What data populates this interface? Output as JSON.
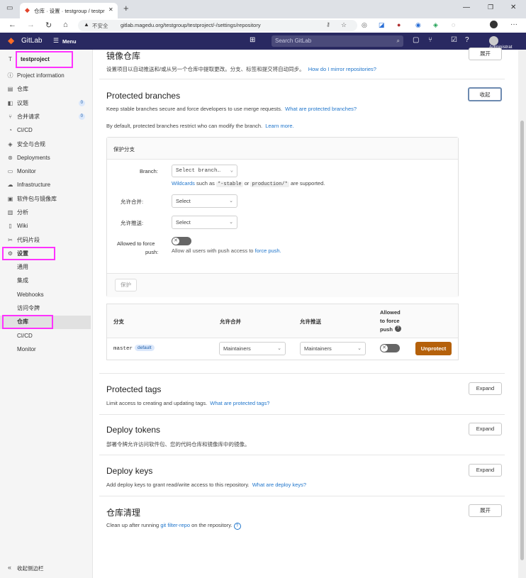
{
  "browser": {
    "tab_title": "仓库 · 设置 · testgroup / testproj",
    "url_warning": "不安全",
    "url": "gitlab.magedu.org/testgroup/testproject/-/settings/repository"
  },
  "header": {
    "logo": "GitLab",
    "menu": "Menu",
    "search_placeholder": "Search GitLab",
    "user": "Administrat"
  },
  "sidebar": {
    "project_initial": "T",
    "project_name": "testproject",
    "items": [
      {
        "icon": "info-icon",
        "label": "Project information"
      },
      {
        "icon": "repository-icon",
        "label": "仓库"
      },
      {
        "icon": "issues-icon",
        "label": "议题",
        "badge": "0"
      },
      {
        "icon": "merge-request-icon",
        "label": "合并请求",
        "badge": "0"
      },
      {
        "icon": "cicd-icon",
        "label": "CI/CD"
      },
      {
        "icon": "shield-icon",
        "label": "安全与合规"
      },
      {
        "icon": "deployments-icon",
        "label": "Deployments"
      },
      {
        "icon": "monitor-icon",
        "label": "Monitor"
      },
      {
        "icon": "infrastructure-icon",
        "label": "Infrastructure"
      },
      {
        "icon": "package-icon",
        "label": "软件包与镜像库"
      },
      {
        "icon": "analytics-icon",
        "label": "分析"
      },
      {
        "icon": "wiki-icon",
        "label": "Wiki"
      },
      {
        "icon": "snippet-icon",
        "label": "代码片段"
      },
      {
        "icon": "gear-icon",
        "label": "设置"
      }
    ],
    "sub_items": [
      "通用",
      "集成",
      "Webhooks",
      "访问令牌",
      "仓库",
      "CI/CD",
      "Monitor"
    ],
    "collapse": "收起侧边栏"
  },
  "main": {
    "mirror": {
      "title": "镜像仓库",
      "desc": "设置项目以自动推送和/或从另一个仓库中提取更改。分支、标签和提交将自动同步。",
      "link": "How do I mirror repositories?",
      "button": "展开"
    },
    "protected_branches": {
      "title": "Protected branches",
      "button": "收起",
      "desc": "Keep stable branches secure and force developers to use merge requests.",
      "desc_link": "What are protected branches?",
      "default_note": "By default, protected branches restrict who can modify the branch.",
      "learn_more": "Learn more.",
      "form": {
        "header": "保护分支",
        "branch_label": "Branch:",
        "branch_placeholder": "Select branch…",
        "wildcards": "Wildcards",
        "wildcards_text1": "such as",
        "wildcard_example1": "*-stable",
        "wildcards_or": "or",
        "wildcard_example2": "production/*",
        "wildcards_text2": "are supported.",
        "merge_label": "允许合并:",
        "merge_placeholder": "Select",
        "push_label": "允许推送:",
        "push_placeholder": "Select",
        "force_label_1": "Allowed to force",
        "force_label_2": "push:",
        "force_help": "Allow all users with push access to",
        "force_help_link": "force push.",
        "protect_button": "保护"
      },
      "table": {
        "headers": [
          "分支",
          "允许合并",
          "允许推送",
          "Allowed",
          "to force",
          "push"
        ],
        "row": {
          "branch": "master",
          "badge": "default",
          "merge": "Maintainers",
          "push": "Maintainers",
          "unprotect": "Unprotect"
        }
      }
    },
    "protected_tags": {
      "title": "Protected tags",
      "desc": "Limit access to creating and updating tags.",
      "link": "What are protected tags?",
      "button": "Expand"
    },
    "deploy_tokens": {
      "title": "Deploy tokens",
      "desc": "部署令牌允许访问软件包、您的代码仓库和镜像库中的镜像。",
      "button": "Expand"
    },
    "deploy_keys": {
      "title": "Deploy keys",
      "desc": "Add deploy keys to grant read/write access to this repository.",
      "link": "What are deploy keys?",
      "button": "Expand"
    },
    "cleanup": {
      "title": "仓库清理",
      "desc": "Clean up after running",
      "link": "git filter-repo",
      "desc2": "on the repository.",
      "button": "展开"
    }
  },
  "colors": {
    "header_bg": "#292961",
    "accent_link": "#1f75cb",
    "unprotect_bg": "#b5610b",
    "highlight": "#ff32ff"
  }
}
